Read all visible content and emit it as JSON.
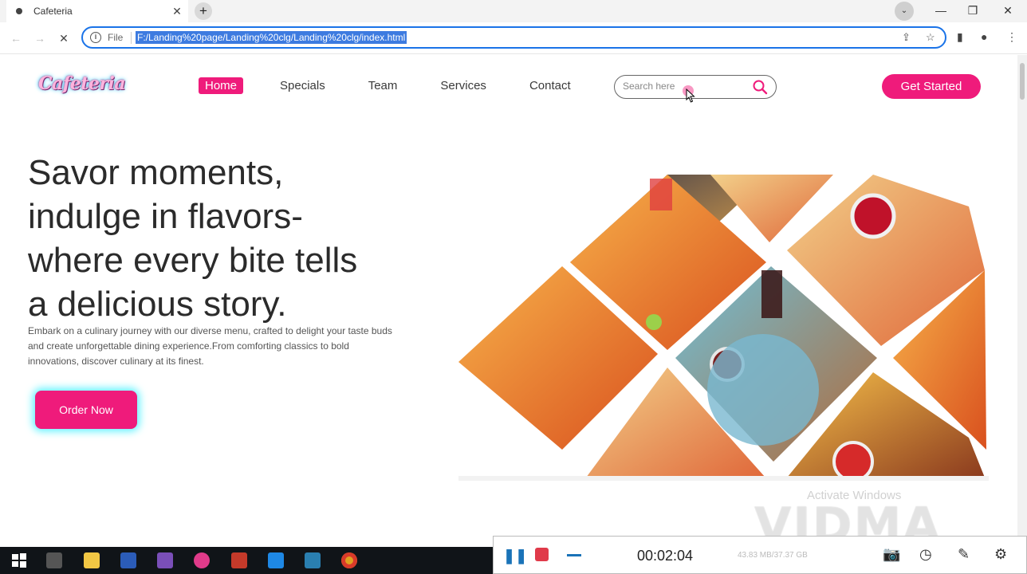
{
  "browser": {
    "tab_title": "Cafeteria",
    "tab_close": "✕",
    "new_tab": "+",
    "scheme_label": "File",
    "url": "F:/Landing%20page/Landing%20clg/Landing%20clg/index.html",
    "window_controls": {
      "minimize": "—",
      "restore": "❐",
      "close": "✕"
    }
  },
  "site": {
    "logo": "Cafeteria",
    "nav": [
      {
        "label": "Home",
        "active": true
      },
      {
        "label": "Specials",
        "active": false
      },
      {
        "label": "Team",
        "active": false
      },
      {
        "label": "Services",
        "active": false
      },
      {
        "label": "Contact",
        "active": false
      }
    ],
    "search_placeholder": "Search here",
    "cta_label": "Get Started",
    "hero": {
      "headline_lines": [
        "Savor moments,",
        "indulge in flavors-",
        "where every bite tells",
        "a delicious story."
      ],
      "description": "Embark on a culinary journey with our diverse menu, crafted to delight your taste buds and create unforgettable dining experience.From comforting classics to bold innovations, discover culinary at its finest.",
      "order_button": "Order Now"
    },
    "colors": {
      "accent": "#ef1b7b",
      "glow": "#5ff2ff"
    }
  },
  "overlay": {
    "activate_windows": "Activate Windows",
    "recorder_brand": "VIDMA",
    "recorder_time": "00:02:04",
    "recorder_size": "43.83 MB/37.37 GB"
  }
}
